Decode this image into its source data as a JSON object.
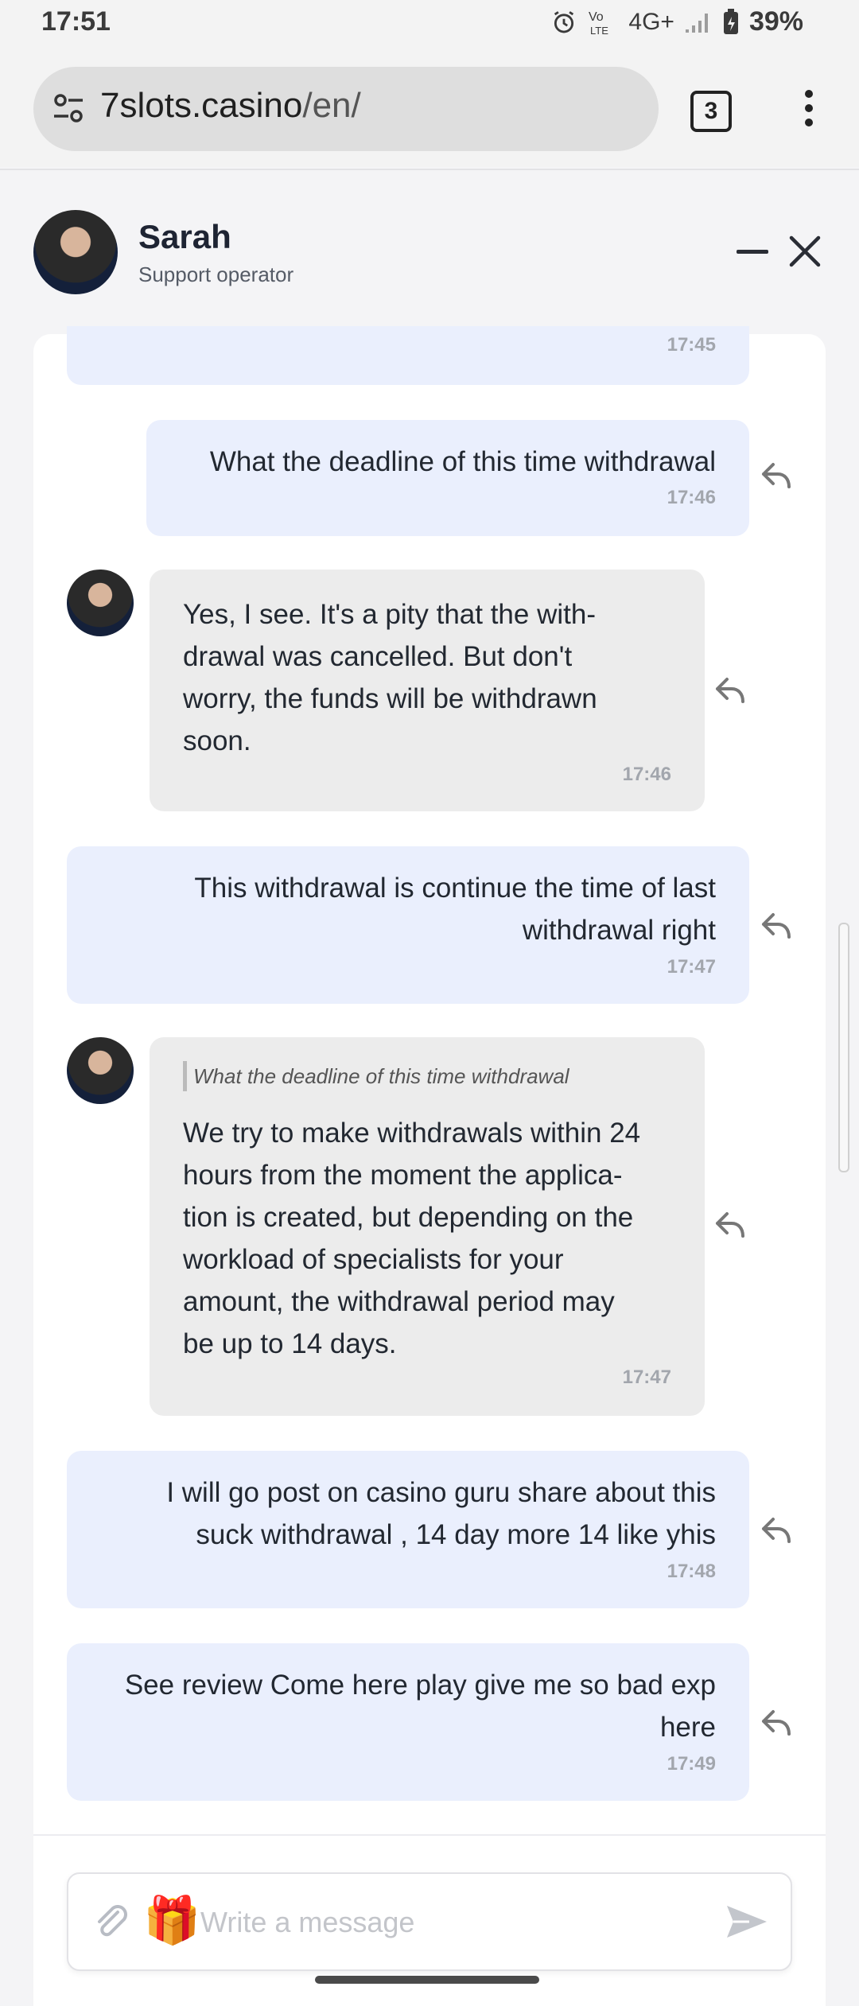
{
  "status_bar": {
    "time": "17:51",
    "network": "4G+",
    "battery": "39%",
    "icons": [
      "alarm-icon",
      "volte-icon",
      "signal-icon",
      "battery-icon"
    ]
  },
  "browser": {
    "url_domain": "7slots.casino",
    "url_path": "/en/",
    "tab_count": "3",
    "icons": [
      "site-settings-icon",
      "overflow-menu-icon"
    ]
  },
  "chat": {
    "agent_name": "Sarah",
    "agent_role": "Support operator",
    "messages": [
      {
        "from": "user",
        "text": "",
        "time": "17:45"
      },
      {
        "from": "user",
        "text": "What the deadline of this time withdrawal",
        "time": "17:46"
      },
      {
        "from": "operator",
        "text_lines": [
          "Yes, I see. It's a pity that the with-",
          "drawal was cancelled. But don't",
          "worry, the funds will be withdrawn",
          "soon."
        ],
        "time": "17:46"
      },
      {
        "from": "user",
        "text_lines": [
          "This withdrawal is continue the time of last",
          "withdrawal right"
        ],
        "time": "17:47"
      },
      {
        "from": "operator",
        "quote": "What the deadline of this time withdrawal",
        "text_lines": [
          "We try to make withdrawals within 24",
          "hours from the moment the applica-",
          "tion is created, but depending on the",
          "workload of specialists for your",
          "amount, the withdrawal period may",
          "be up to 14 days."
        ],
        "time": "17:47"
      },
      {
        "from": "user",
        "text_lines": [
          "I will go post on casino guru share about this",
          "suck withdrawal , 14 day more 14 like yhis"
        ],
        "time": "17:48"
      },
      {
        "from": "user",
        "text_lines": [
          "See review Come here play give me so bad exp",
          "here"
        ],
        "time": "17:49"
      }
    ]
  },
  "composer": {
    "placeholder": "Write a message",
    "value": "",
    "icons": [
      "attach-icon",
      "gift-icon",
      "send-icon"
    ]
  },
  "colors": {
    "user_bubble": "#eaeffd",
    "operator_bubble": "#ececec",
    "timestamp": "#a2a6ad",
    "text": "#222831"
  }
}
